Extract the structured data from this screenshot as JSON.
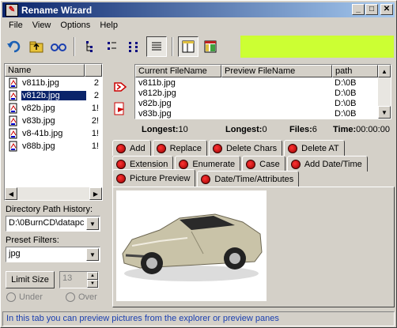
{
  "window": {
    "title": "Rename Wizard"
  },
  "menu": [
    "File",
    "View",
    "Options",
    "Help"
  ],
  "toolbar_icons": [
    "undo-icon",
    "folder-up-icon",
    "glasses-icon",
    "tree-view-icon",
    "list-view-icon",
    "small-icons-icon",
    "details-icon",
    "panel-icon",
    "colorful-panel-icon"
  ],
  "left_list": {
    "header": "Name",
    "items": [
      {
        "name": "v811b.jpg",
        "size": "2"
      },
      {
        "name": "v812b.jpg",
        "size": "2"
      },
      {
        "name": "v82b.jpg",
        "size": "1!"
      },
      {
        "name": "v83b.jpg",
        "size": "2!"
      },
      {
        "name": "v8-41b.jpg",
        "size": "1!"
      },
      {
        "name": "v88b.jpg",
        "size": "1!"
      }
    ],
    "selected_index": 1
  },
  "dir_history": {
    "label": "Directory Path History:",
    "value": "D:\\0BurnCD\\datapc"
  },
  "preset_filters": {
    "label": "Preset Filters:",
    "value": "jpg"
  },
  "limit": {
    "button": "Limit Size",
    "value": "13",
    "under": "Under",
    "over": "Over"
  },
  "file_table": {
    "columns": [
      "Current FileName",
      "Preview FileName",
      "path"
    ],
    "rows": [
      {
        "current": "v811b.jpg",
        "preview": "",
        "path": "D:\\0B"
      },
      {
        "current": "v812b.jpg",
        "preview": "",
        "path": "D:\\0B"
      },
      {
        "current": "v82b.jpg",
        "preview": "",
        "path": "D:\\0B"
      },
      {
        "current": "v83b.jpg",
        "preview": "",
        "path": "D:\\0B"
      }
    ]
  },
  "stats": {
    "longest_label": "Longest:",
    "longest_value": "10",
    "longest2_label": "Longest:",
    "longest2_value": "0",
    "files_label": "Files:",
    "files_value": "6",
    "time_label": "Time:",
    "time_value": "00:00:00"
  },
  "tabs_row1": [
    "Add",
    "Replace",
    "Delete Chars",
    "Delete AT"
  ],
  "tabs_row2": [
    "Extension",
    "Enumerate",
    "Case",
    "Add Date/Time"
  ],
  "tabs_row3": [
    "Picture Preview",
    "Date/Time/Attributes"
  ],
  "status": "In this tab you can preview pictures from the explorer or preview panes",
  "colors": {
    "title_start": "#0a246a",
    "lime": "#ccff33",
    "status_text": "#1a3fb0"
  }
}
